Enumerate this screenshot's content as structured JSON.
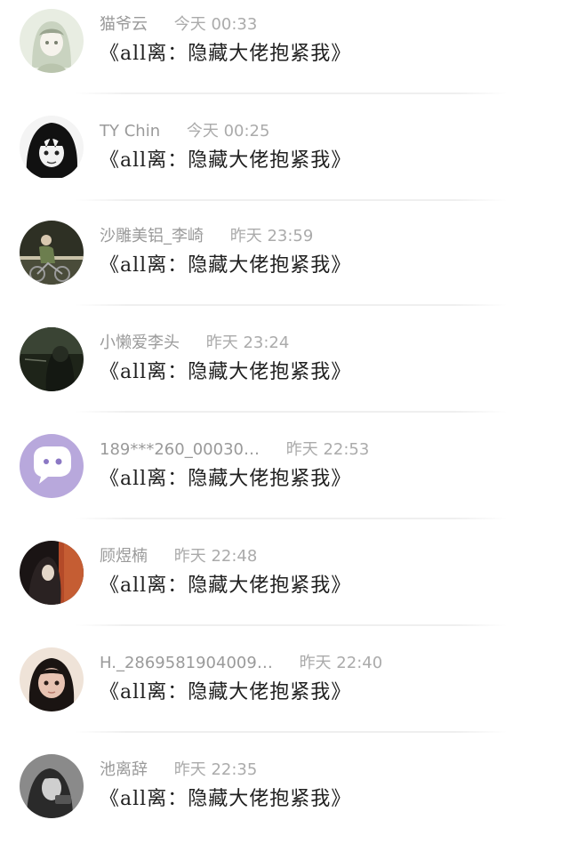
{
  "comments": [
    {
      "name": "猫爷云",
      "time": "今天 00:33",
      "message": "《all离：隐藏大佬抱紧我》",
      "avatar_icon": "anime-girl-avatar-icon",
      "avatar_colors": [
        "#e8ede2",
        "#c9d3c0",
        "#9aa48f"
      ]
    },
    {
      "name": "TY Chin",
      "time": "今天 00:25",
      "message": "《all离：隐藏大佬抱紧我》",
      "avatar_icon": "dark-hair-avatar-icon",
      "avatar_colors": [
        "#f4f4f4",
        "#111111",
        "#6a6a6a"
      ]
    },
    {
      "name": "沙雕美铝_李崎",
      "time": "昨天 23:59",
      "message": "《all离：隐藏大佬抱紧我》",
      "avatar_icon": "cyclist-avatar-icon",
      "avatar_colors": [
        "#2e3024",
        "#6c7e4e",
        "#c9c2a8"
      ]
    },
    {
      "name": "小懒爱李头",
      "time": "昨天 23:24",
      "message": "《all离：隐藏大佬抱紧我》",
      "avatar_icon": "dark-silhouette-avatar-icon",
      "avatar_colors": [
        "#1e2419",
        "#3a4434",
        "#6a7060"
      ]
    },
    {
      "name": "189***260_00030…",
      "time": "昨天 22:53",
      "message": "《all离：隐藏大佬抱紧我》",
      "avatar_icon": "chat-bubble-default-avatar-icon",
      "avatar_colors": [
        "#b8a8dc",
        "#ffffff",
        "#8b78c4"
      ]
    },
    {
      "name": "顾煜楠",
      "time": "昨天 22:48",
      "message": "《all离：隐藏大佬抱紧我》",
      "avatar_icon": "hooded-figure-avatar-icon",
      "avatar_colors": [
        "#1a1414",
        "#b44a28",
        "#e3d6c8"
      ]
    },
    {
      "name": "H._2869581904009…",
      "time": "昨天 22:40",
      "message": "《all离：隐藏大佬抱紧我》",
      "avatar_icon": "child-portrait-avatar-icon",
      "avatar_colors": [
        "#efe3d8",
        "#1a1412",
        "#e7c3b2"
      ]
    },
    {
      "name": "池离辞",
      "time": "昨天 22:35",
      "message": "《all离：隐藏大佬抱紧我》",
      "avatar_icon": "gray-portrait-avatar-icon",
      "avatar_colors": [
        "#8a8a8a",
        "#2a2a2a",
        "#cfcfcf"
      ]
    }
  ]
}
